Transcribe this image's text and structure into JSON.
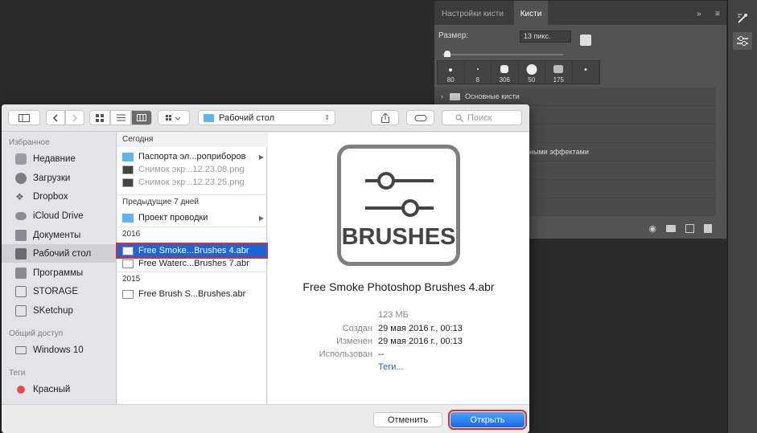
{
  "photoshop": {
    "tabs": [
      "Настройки кисти",
      "Кисти"
    ],
    "size_label": "Размер:",
    "size_value": "13 пикс.",
    "presets": [
      "80",
      "8",
      "306",
      "50",
      "175",
      ""
    ],
    "folders": [
      "Основные кисти",
      "",
      "",
      "ными эффектами",
      "",
      ""
    ]
  },
  "dialog": {
    "location": "Рабочий стол",
    "search_placeholder": "Поиск",
    "sidebar": {
      "favorites_heading": "Избранное",
      "favorites": [
        "Недавние",
        "Загрузки",
        "Dropbox",
        "iCloud Drive",
        "Документы",
        "Рабочий стол",
        "Программы",
        "STORAGE",
        "SKetchup"
      ],
      "shared_heading": "Общий доступ",
      "shared": [
        "Windows 10"
      ],
      "tags_heading": "Теги",
      "tags": [
        "Красный"
      ],
      "tag_color": "#e84a4a"
    },
    "column": {
      "groups": [
        "Сегодня",
        "Предыдущие 7 дней",
        "2016",
        "2015"
      ],
      "today": [
        "Паспорта эл...роприборов",
        "Снимок экр...12.23.08.png",
        "Снимок экр...12.23.25.png"
      ],
      "week": [
        "Проект проводки"
      ],
      "y2016": [
        "Free Smoke...Brushes 4.abr",
        "Free Waterc...Brushes 7.abr"
      ],
      "y2015": [
        "Free Brush S...Brushes.abr"
      ]
    },
    "preview": {
      "icon_text": "BRUSHES",
      "file_name": "Free Smoke Photoshop Brushes 4.abr",
      "size": "123 МБ",
      "created_label": "Создан",
      "created": "29 мая 2016 г., 00:13",
      "modified_label": "Изменен",
      "modified": "29 мая 2016 г., 00:13",
      "used_label": "Использован",
      "used": "--",
      "tags_link": "Теги..."
    },
    "cancel_label": "Отменить",
    "open_label": "Открыть"
  },
  "colors": {
    "accent": "#1b67d6",
    "highlight_border": "#d92c2c",
    "folder": "#5fb5f3"
  }
}
